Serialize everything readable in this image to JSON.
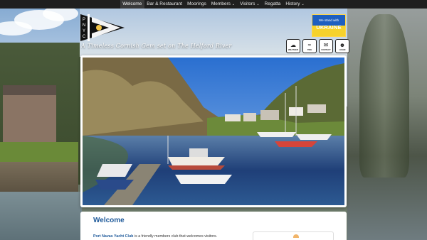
{
  "nav": {
    "items": [
      {
        "label": "Welcome",
        "active": true,
        "has_dropdown": false
      },
      {
        "label": "Bar & Restaurant",
        "active": false,
        "has_dropdown": false
      },
      {
        "label": "Moorings",
        "active": false,
        "has_dropdown": false
      },
      {
        "label": "Members",
        "active": false,
        "has_dropdown": true
      },
      {
        "label": "Visitors",
        "active": false,
        "has_dropdown": true
      },
      {
        "label": "Regatta",
        "active": false,
        "has_dropdown": false
      },
      {
        "label": "History",
        "active": false,
        "has_dropdown": true
      }
    ]
  },
  "header": {
    "burgee_letters": [
      "P",
      "N",
      "Y",
      "C"
    ],
    "tagline": "A Timeless Cornish Gem set on The Helford River"
  },
  "ukraine": {
    "line1": "We stand with",
    "line2": "UKRAINE",
    "colors": {
      "blue": "#1e5fc0",
      "yellow": "#f6d22c"
    }
  },
  "quick_links": [
    {
      "label": "WEATHER",
      "icon": "weather-icon"
    },
    {
      "label": "TIDE",
      "icon": "tide-icon"
    },
    {
      "label": "CONTACT",
      "icon": "contact-icon"
    },
    {
      "label": "LOGIN",
      "icon": "login-icon"
    }
  ],
  "welcome": {
    "title": "Welcome",
    "club_name": "Port Navas Yacht Club",
    "intro_rest": " is a friendly members club that welcomes visitors."
  },
  "colors": {
    "navbar": "#1f1f1f",
    "heading": "#1f5a9a"
  }
}
